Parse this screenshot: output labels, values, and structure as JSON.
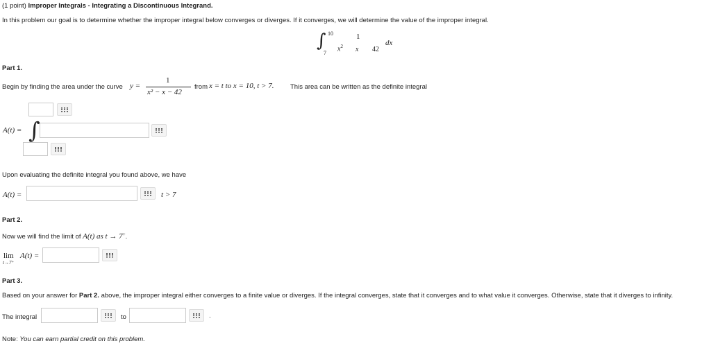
{
  "header": {
    "points": "(1 point)",
    "title": "Improper Integrals - Integrating a Discontinuous Integrand."
  },
  "intro": "In this problem our goal is to determine whether the improper integral below converges or diverges. If it converges, we will determine the value of the improper integral.",
  "main_integral": {
    "upper": "10",
    "lower": "7",
    "numerator": "1",
    "den_x2": "x",
    "den_x2_exp": "2",
    "den_x": "x",
    "den_42": "42",
    "dx": "dx"
  },
  "part1": {
    "heading": "Part 1.",
    "text_before": "Begin by finding the area under the curve",
    "y_eq": "y =",
    "frac_num": "1",
    "frac_den": "x² − x − 42",
    "text_from": "from",
    "range_math": "x = t to x = 10, t > 7.",
    "text_after": "This area can be written as the definite integral",
    "A_label": "A(t) =",
    "evaluating_text": "Upon evaluating the definite integral you found above, we have",
    "A_label2": "A(t) =",
    "condition": "t > 7"
  },
  "part2": {
    "heading": "Part 2.",
    "text": "Now we will find the limit of",
    "text_math": "A(t) as t → 7",
    "text_sup": "+",
    "text_end": ".",
    "lim": "lim",
    "lim_sub": "t→7⁺",
    "lim_expr": "A(t) ="
  },
  "part3": {
    "heading": "Part 3.",
    "text_start": "Based on your answer for",
    "text_bold": "Part 2.",
    "text_end": "above, the improper integral either converges to a finite value or diverges. If the integral converges, state that it converges and to what value it converges. Otherwise, state that it diverges to infinity.",
    "label": "The integral",
    "to": "to",
    "period": "."
  },
  "note": {
    "label": "Note:",
    "text": "You can earn partial credit on this problem."
  }
}
